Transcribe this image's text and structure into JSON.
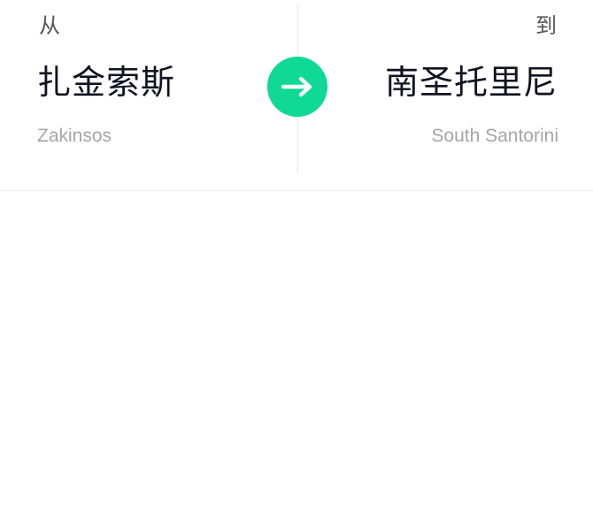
{
  "route": {
    "from": {
      "label": "从",
      "city": "扎金索斯",
      "city_latin": "Zakinsos"
    },
    "to": {
      "label": "到",
      "city": "南圣托里尼",
      "city_latin": "South Santorini"
    },
    "direction_icon": "arrow-right-icon"
  },
  "colors": {
    "accent": "#0fd994",
    "title_text": "#111122",
    "label_text": "#555555",
    "subtext": "#a6a6a6",
    "divider": "#e8e8e8",
    "background": "#ffffff"
  }
}
